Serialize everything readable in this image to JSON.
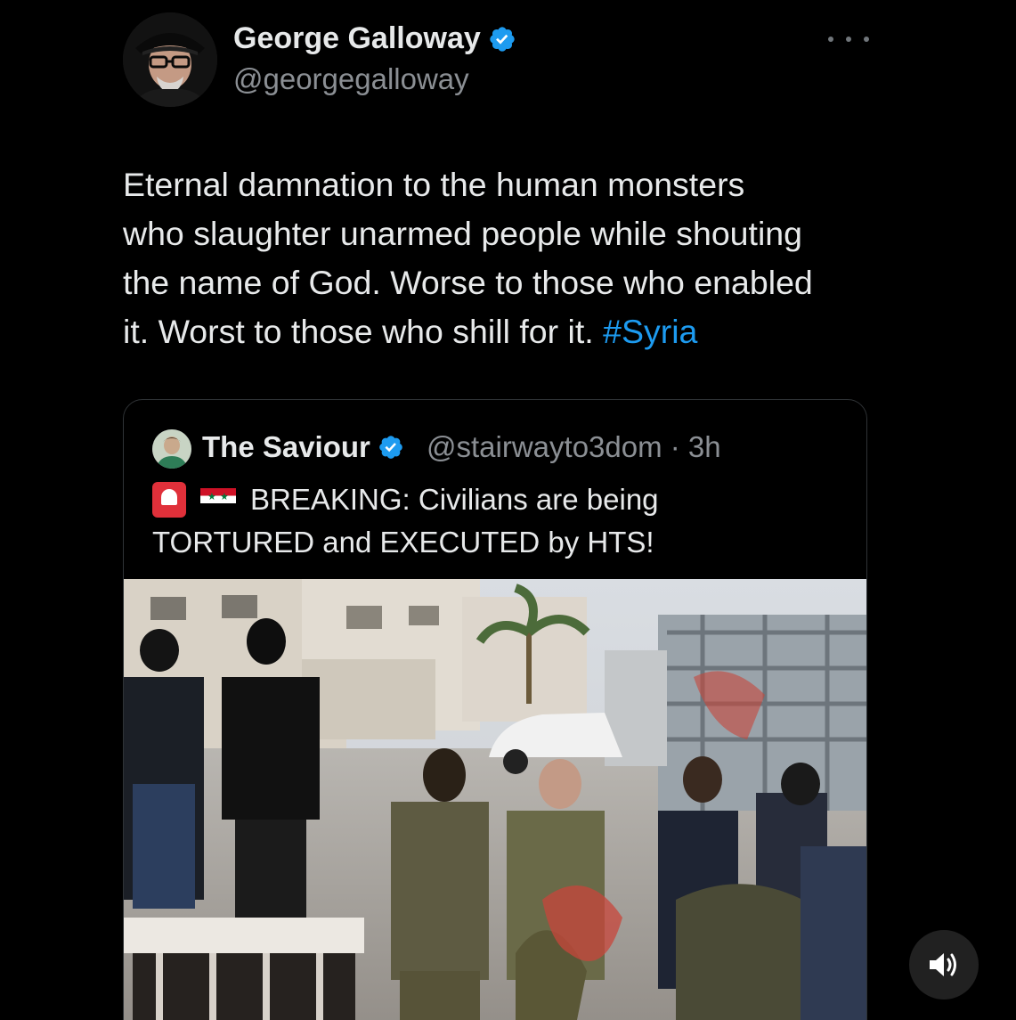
{
  "tweet": {
    "author_name": "George Galloway",
    "author_handle": "@georgegalloway",
    "text_lines": [
      "Eternal damnation to the human monsters",
      "who slaughter unarmed people while shouting",
      "the name of God. Worse to those who enabled",
      "it. Worst to those who shill for it. "
    ],
    "hashtag": "#Syria",
    "verified_icon": "verified-badge-icon",
    "more_icon": "more-options-icon"
  },
  "quote": {
    "author_name": "The Saviour",
    "author_handle": "@stairwayto3dom · 3h",
    "line1": "BREAKING: Civilians are being",
    "line2": "TORTURED and EXECUTED by HTS!",
    "emoji_1": "siren-emoji",
    "emoji_2": "syria-flag-emoji"
  },
  "media": {
    "description_icon": "video-thumbnail"
  },
  "controls": {
    "volume_icon": "speaker-volume-icon"
  },
  "colors": {
    "background": "#000000",
    "text": "#e7e9ea",
    "muted": "#8b8f94",
    "link": "#1d9bf0",
    "verified": "#1d9bf0",
    "border": "#2f3336"
  }
}
